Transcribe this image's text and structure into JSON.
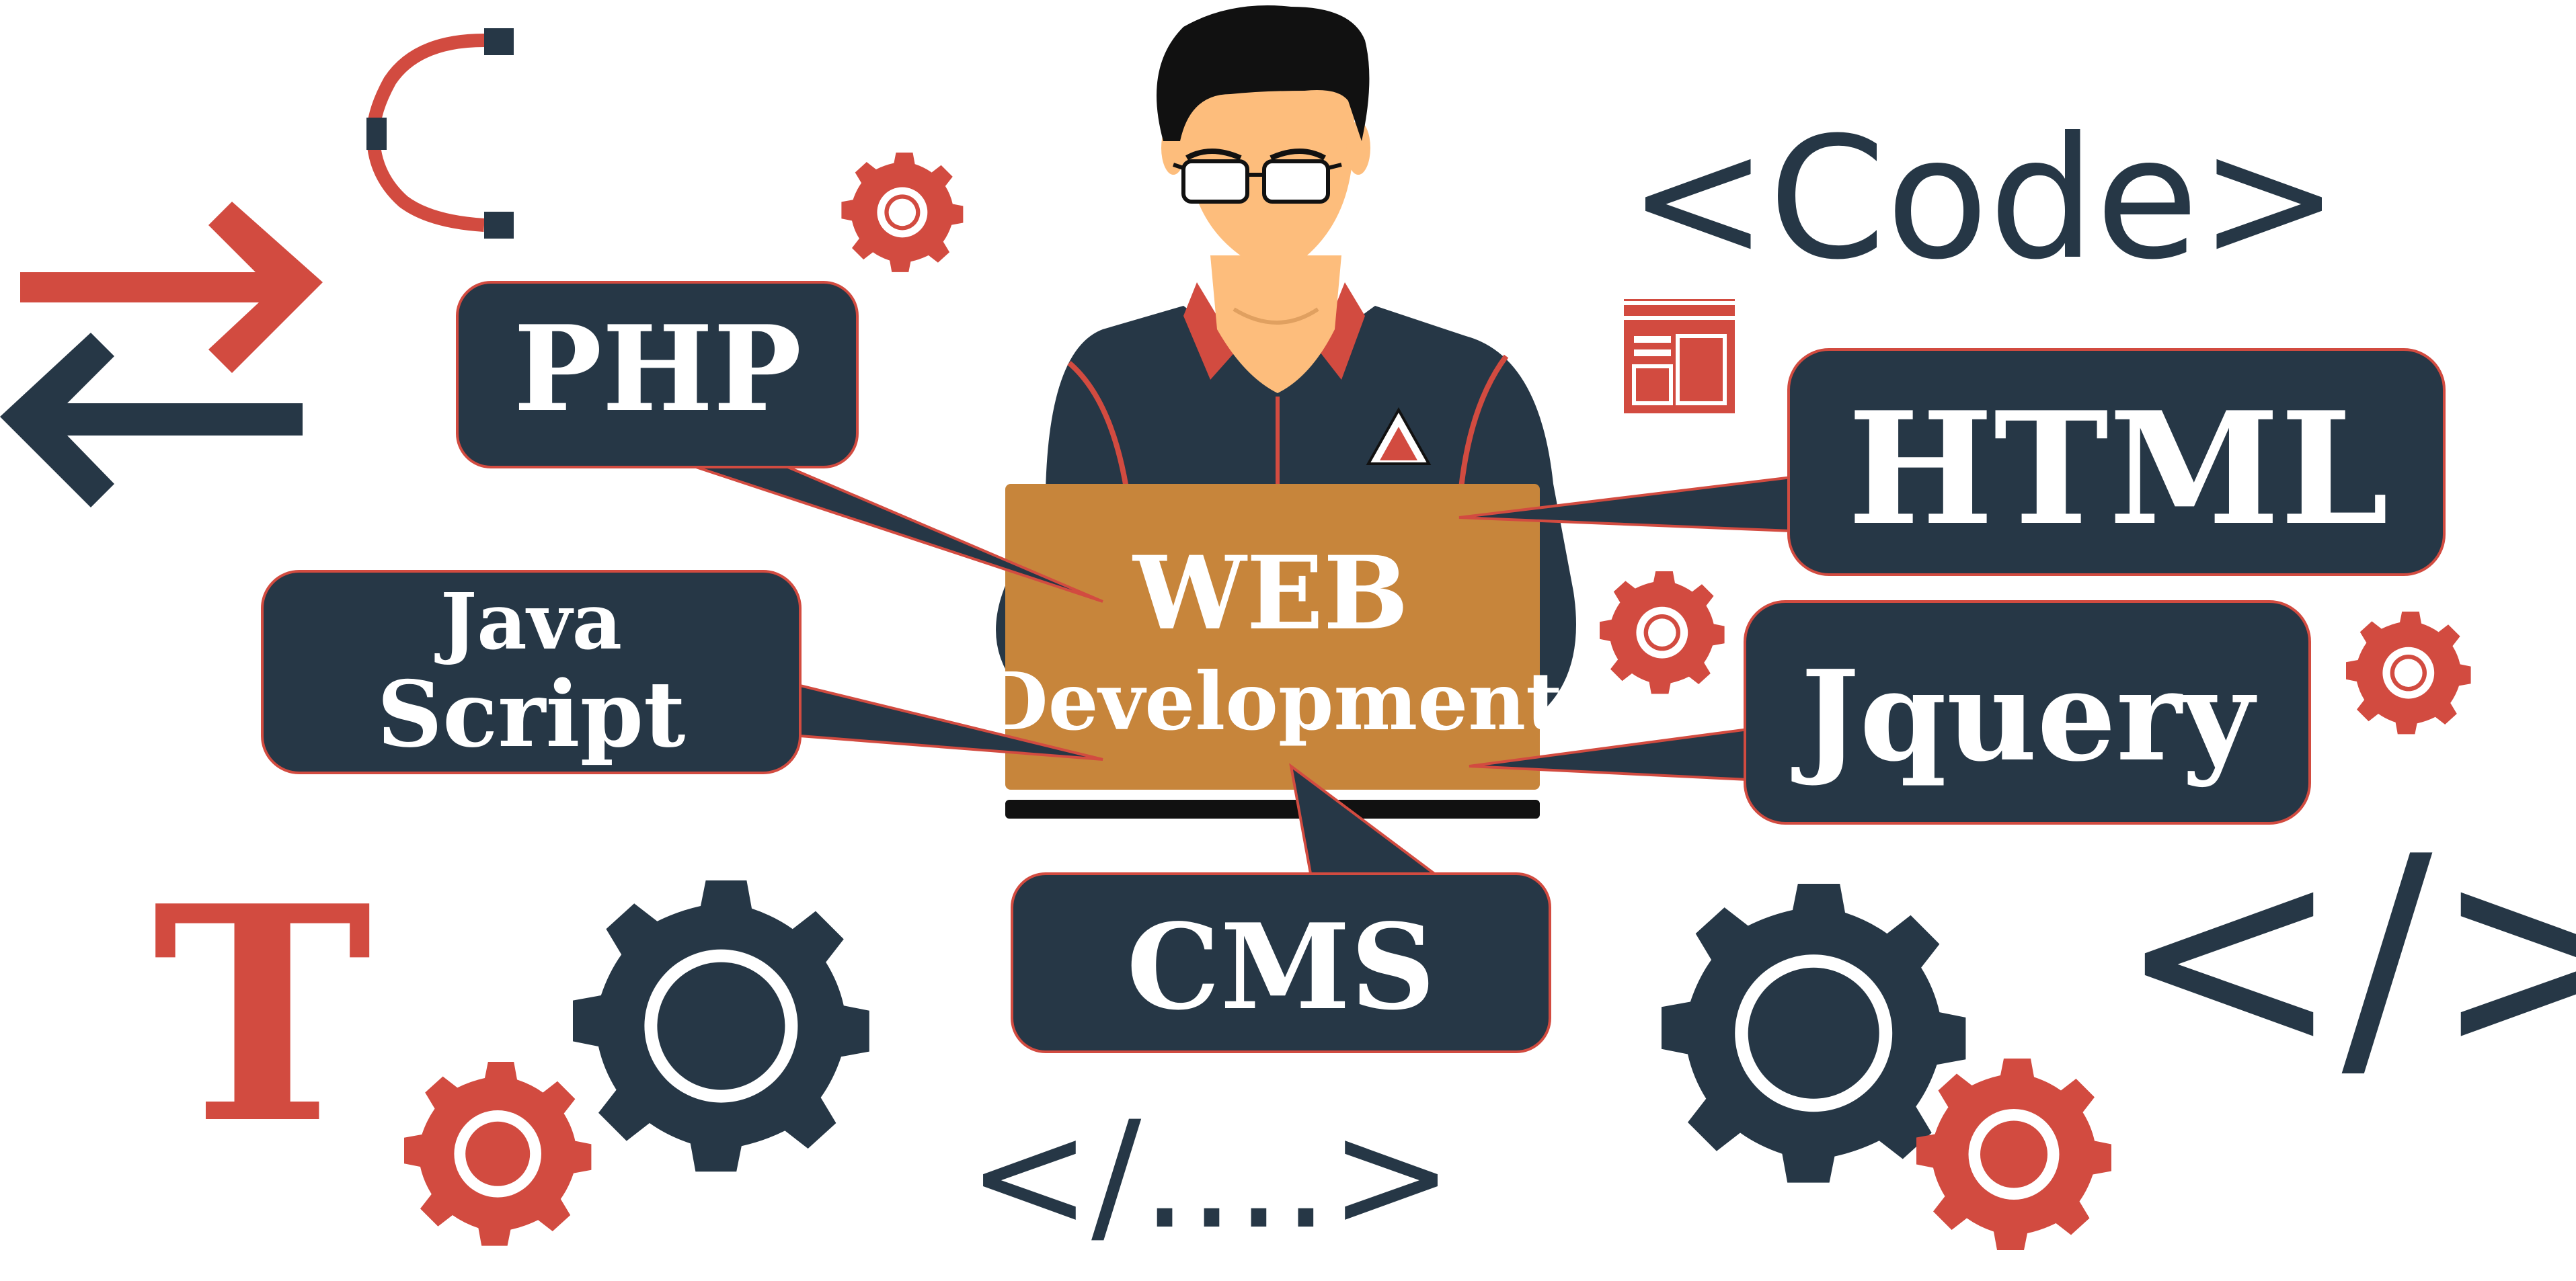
{
  "labels": {
    "php": "PHP",
    "java": "Java",
    "script": "Script",
    "html": "HTML",
    "jquery": "Jquery",
    "cms": "CMS",
    "web": "WEB",
    "development": "Development",
    "code": "<Code>",
    "close_tag": "</>",
    "close_tag_dots": "</....>",
    "t_letter": "T"
  },
  "colors": {
    "navy": "#263746",
    "red": "#d24b40",
    "orange": "#c7853b",
    "skin": "#fdbd7c",
    "hair": "#111111"
  },
  "icons": [
    "exchange-arrows-icon",
    "cable-connector-icon",
    "gear-icon",
    "layout-page-icon",
    "logo-triangle-icon"
  ]
}
